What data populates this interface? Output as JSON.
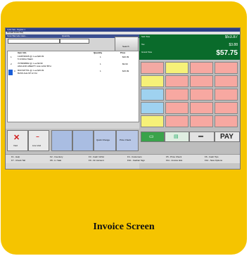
{
  "caption": "Invoice Screen",
  "titlebar": {
    "text": "Quick Sale - Register 1"
  },
  "menu": {
    "text": "File  Edit  Invoice  Help"
  },
  "search": {
    "label": "Scan Barcode Here...",
    "qty_label": "Quantity",
    "button": "Search"
  },
  "table": {
    "headers": [
      "Item Info",
      "Quantity",
      "Price"
    ],
    "rows": [
      {
        "num": "1",
        "info": "1348796335 @ 1 ea $20.99",
        "info2": "5 VODKA TEEN",
        "qty": "1",
        "price": "$20.99"
      },
      {
        "num": "2",
        "info": "7078398582 @ 1 ea $9.99",
        "info2": "ANCHOR LIBERTY ALE 12OZ BTH",
        "qty": "1",
        "price": "$9.99"
      },
      {
        "num": "3",
        "info": "8037187751 @ 1 ea $15.99",
        "info2": "BASS ALE 6P 12 FH",
        "qty": "1",
        "price": "$15.99"
      }
    ]
  },
  "bottom_buttons": [
    "Void",
    "Line Void",
    "",
    "",
    "Quick Change",
    "Price Check"
  ],
  "totals": {
    "sub_label": "Sub Total",
    "sub_val": "$53.87",
    "tax_label": "Tax",
    "tax_val": "$3.88",
    "grand_label": "Grand Total",
    "grand_val": "$57.75"
  },
  "pay": {
    "label": "PAY"
  },
  "colors": {
    "card": "#f5c400",
    "totals_bg": "#0a6b2b",
    "selected": "#1a5ed8"
  },
  "grid_colors": [
    "#f3a9a3",
    "#f6f178",
    "#f7a8a1",
    "#f7a8a1",
    "#f6f178",
    "#f7a8a1",
    "#f7a8a1",
    "#f7a8a1",
    "#9fd2f0",
    "#f7a8a1",
    "#f7a8a1",
    "#f7a8a1",
    "#9fd2f0",
    "#f7a8a1",
    "#f7a8a1",
    "#f7a8a1",
    "#f6f178",
    "#f7a8a1",
    "#f7a8a1",
    "#f7a8a1"
  ],
  "fkeys": [
    "F1 - Help",
    "F2 - Inventory",
    "F3 - Cash In/Out",
    "F4 - Customers",
    "F5 - Price Check",
    "F6 - Cash Tips",
    "F7 - Check Tab",
    "F8 - Lt. Sale",
    "F9 - On Account",
    "F10 - Cashier Sign",
    "F11 - Invoice Hist.",
    "F12 - New Options"
  ]
}
